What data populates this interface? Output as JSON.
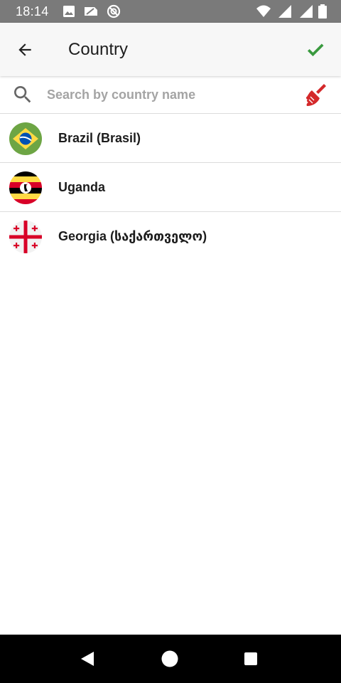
{
  "status_bar": {
    "time": "18:14",
    "left_icons": [
      "image-icon",
      "sim-icon",
      "blocked-icon"
    ],
    "right_icons": [
      "wifi-icon",
      "signal-icon",
      "signal-icon",
      "battery-icon"
    ]
  },
  "app_bar": {
    "title": "Country",
    "back_icon": "arrow-left-icon",
    "confirm_icon": "checkmark-icon",
    "confirm_color": "#3a9a3f"
  },
  "search": {
    "value": "",
    "placeholder": "Search by country name",
    "search_icon": "search-icon",
    "clear_icon": "broom-icon",
    "clear_color": "#d4282a"
  },
  "countries": [
    {
      "name": "Brazil (Brasil)",
      "flag": "brazil-flag-icon"
    },
    {
      "name": "Uganda",
      "flag": "uganda-flag-icon"
    },
    {
      "name": "Georgia (საქართველო)",
      "flag": "georgia-flag-icon"
    }
  ],
  "nav_bar": {
    "icons": [
      "back-triangle-icon",
      "home-circle-icon",
      "recents-square-icon"
    ]
  }
}
